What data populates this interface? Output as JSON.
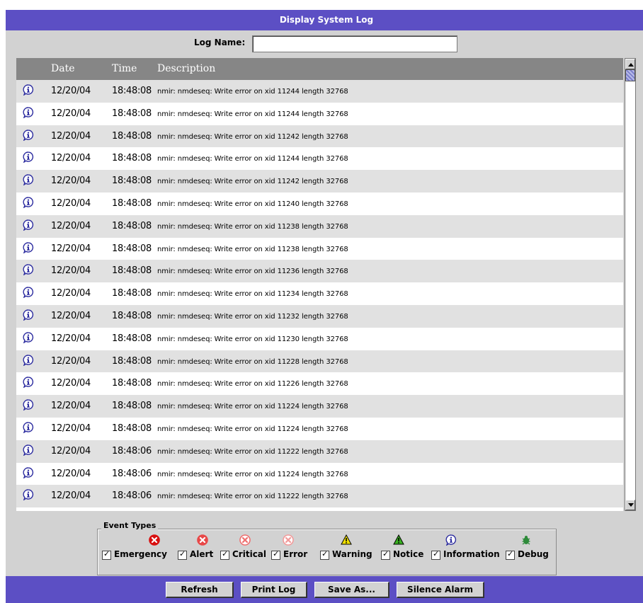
{
  "window": {
    "title": "Display System Log"
  },
  "log_name": {
    "label": "Log Name:",
    "value": ""
  },
  "table": {
    "columns": [
      "Date",
      "Time",
      "Description"
    ],
    "rows": [
      {
        "date": "12/20/04",
        "time": "18:48:08",
        "desc": "nmir: nmdeseq: Write error on xid 11244 length 32768",
        "icon": "information-icon"
      },
      {
        "date": "12/20/04",
        "time": "18:48:08",
        "desc": "nmir: nmdeseq: Write error on xid 11244 length 32768",
        "icon": "information-icon"
      },
      {
        "date": "12/20/04",
        "time": "18:48:08",
        "desc": "nmir: nmdeseq: Write error on xid 11242 length 32768",
        "icon": "information-icon"
      },
      {
        "date": "12/20/04",
        "time": "18:48:08",
        "desc": "nmir: nmdeseq: Write error on xid 11244 length 32768",
        "icon": "information-icon"
      },
      {
        "date": "12/20/04",
        "time": "18:48:08",
        "desc": "nmir: nmdeseq: Write error on xid 11242 length 32768",
        "icon": "information-icon"
      },
      {
        "date": "12/20/04",
        "time": "18:48:08",
        "desc": "nmir: nmdeseq: Write error on xid 11240 length 32768",
        "icon": "information-icon"
      },
      {
        "date": "12/20/04",
        "time": "18:48:08",
        "desc": "nmir: nmdeseq: Write error on xid 11238 length 32768",
        "icon": "information-icon"
      },
      {
        "date": "12/20/04",
        "time": "18:48:08",
        "desc": "nmir: nmdeseq: Write error on xid 11238 length 32768",
        "icon": "information-icon"
      },
      {
        "date": "12/20/04",
        "time": "18:48:08",
        "desc": "nmir: nmdeseq: Write error on xid 11236 length 32768",
        "icon": "information-icon"
      },
      {
        "date": "12/20/04",
        "time": "18:48:08",
        "desc": "nmir: nmdeseq: Write error on xid 11234 length 32768",
        "icon": "information-icon"
      },
      {
        "date": "12/20/04",
        "time": "18:48:08",
        "desc": "nmir: nmdeseq: Write error on xid 11232 length 32768",
        "icon": "information-icon"
      },
      {
        "date": "12/20/04",
        "time": "18:48:08",
        "desc": "nmir: nmdeseq: Write error on xid 11230 length 32768",
        "icon": "information-icon"
      },
      {
        "date": "12/20/04",
        "time": "18:48:08",
        "desc": "nmir: nmdeseq: Write error on xid 11228 length 32768",
        "icon": "information-icon"
      },
      {
        "date": "12/20/04",
        "time": "18:48:08",
        "desc": "nmir: nmdeseq: Write error on xid 11226 length 32768",
        "icon": "information-icon"
      },
      {
        "date": "12/20/04",
        "time": "18:48:08",
        "desc": "nmir: nmdeseq: Write error on xid 11224 length 32768",
        "icon": "information-icon"
      },
      {
        "date": "12/20/04",
        "time": "18:48:08",
        "desc": "nmir: nmdeseq: Write error on xid 11224 length 32768",
        "icon": "information-icon"
      },
      {
        "date": "12/20/04",
        "time": "18:48:06",
        "desc": "nmir: nmdeseq: Write error on xid 11222 length 32768",
        "icon": "information-icon"
      },
      {
        "date": "12/20/04",
        "time": "18:48:06",
        "desc": "nmir: nmdeseq: Write error on xid 11224 length 32768",
        "icon": "information-icon"
      },
      {
        "date": "12/20/04",
        "time": "18:48:06",
        "desc": "nmir: nmdeseq: Write error on xid 11222 length 32768",
        "icon": "information-icon"
      }
    ]
  },
  "event_types": {
    "legend": "Event Types",
    "items": [
      {
        "label": "Emergency",
        "checked": true,
        "icon": "emergency-icon",
        "color": "#d81010"
      },
      {
        "label": "Alert",
        "checked": true,
        "icon": "alert-icon",
        "color": "#e84848"
      },
      {
        "label": "Critical",
        "checked": true,
        "icon": "critical-icon",
        "color": "#ef7070"
      },
      {
        "label": "Error",
        "checked": true,
        "icon": "error-icon",
        "color": "#f29a9a"
      },
      {
        "label": "Warning",
        "checked": true,
        "icon": "warning-icon",
        "color": "#f0e000"
      },
      {
        "label": "Notice",
        "checked": true,
        "icon": "notice-icon",
        "color": "#38b020"
      },
      {
        "label": "Information",
        "checked": true,
        "icon": "information-icon",
        "color": "#2b2b9f"
      },
      {
        "label": "Debug",
        "checked": true,
        "icon": "debug-bug-icon",
        "color": "#2e8b3a"
      }
    ]
  },
  "buttons": {
    "refresh": "Refresh",
    "print_log": "Print Log",
    "save_as": "Save As...",
    "silence_alarm": "Silence Alarm"
  },
  "colors": {
    "header_bar": "#5c4fc4",
    "window_bg": "#d2d2d2",
    "table_header": "#868686",
    "row_alt": "#e1e1e1"
  }
}
